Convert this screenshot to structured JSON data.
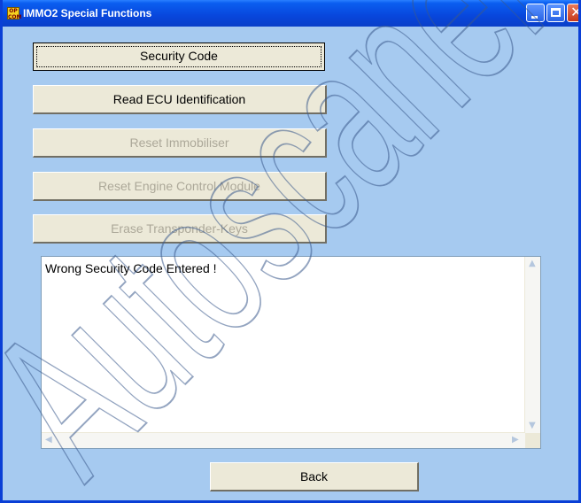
{
  "window": {
    "title": "IMMO2 Special Functions",
    "icon_label": "OP COM"
  },
  "buttons": {
    "security_code": "Security Code",
    "read_ecu": "Read ECU Identification",
    "reset_immobiliser": "Reset Immobiliser",
    "reset_ecm": "Reset Engine Control Module",
    "erase_keys": "Erase Transponder-Keys",
    "back": "Back"
  },
  "output": {
    "message": "Wrong Security Code Entered !"
  },
  "watermark": {
    "text": "Autoscaner"
  },
  "colors": {
    "client_bg": "#a6caf0",
    "titlebar": "#0846dc",
    "button_face": "#ece9d8",
    "disabled_text": "#aca899",
    "watermark": "#3a5a8c"
  }
}
